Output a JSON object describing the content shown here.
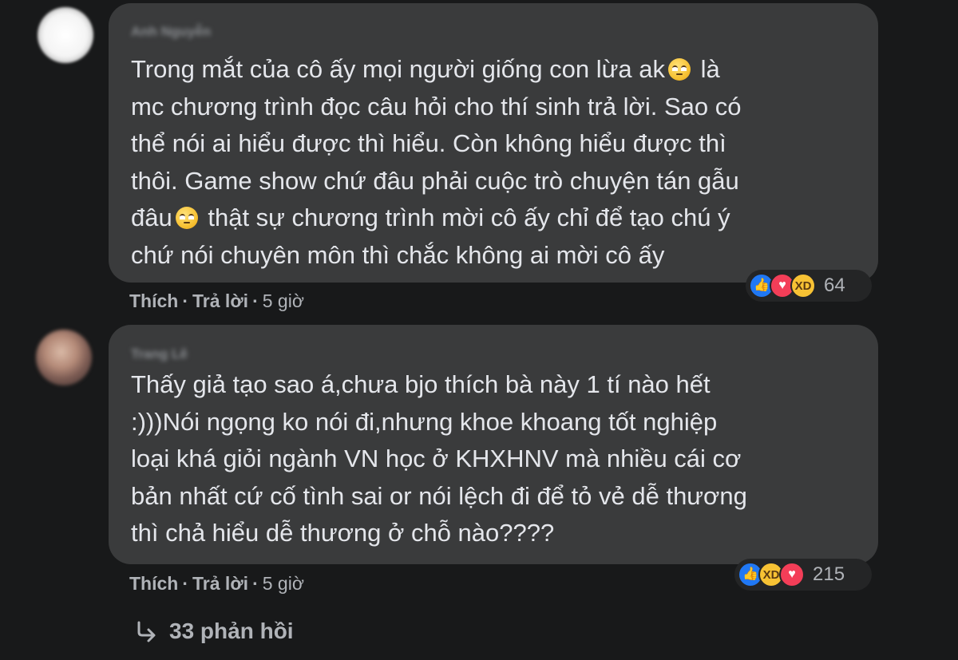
{
  "comments": [
    {
      "author": "Anh Nguyễn",
      "lines": [
        {
          "text": "Trong mắt của cô ấy mọi người giống con lừa ak",
          "emoji_after": "rolling-eyes",
          "tail": "là"
        },
        {
          "text": "mc chương trình đọc câu hỏi cho thí sinh trả lời. Sao có",
          "tail": ""
        },
        {
          "text": "thể nói ai hiểu được thì hiểu. Còn không hiểu được thì",
          "tail": ""
        },
        {
          "text": "thôi. Game show chứ đâu phải cuộc trò chuyện tán gẫu",
          "tail": ""
        },
        {
          "text": "đâu",
          "emoji_after": "rolling-eyes",
          "tail": "thật sự chương trình mời cô ấy chỉ để tạo chú ý"
        },
        {
          "text": "chứ nói chuyên môn thì chắc không ai mời cô ấy",
          "tail": ""
        }
      ],
      "reactions": [
        "like",
        "love",
        "haha"
      ],
      "reaction_count": "64",
      "like_label": "Thích",
      "reply_label": "Trả lời",
      "separator": "·",
      "time": "5 giờ"
    },
    {
      "author": "Trang Lê",
      "lines": [
        {
          "text": "Thấy giả tạo sao á,chưa bjo thích bà này 1 tí nào hết",
          "tail": ""
        },
        {
          "text": ":)))Nói ngọng ko nói đi,nhưng khoe khoang tốt nghiệp",
          "tail": ""
        },
        {
          "text": "loại khá giỏi ngành VN học ở KHXHNV mà nhiều cái cơ",
          "tail": ""
        },
        {
          "text": "bản nhất cứ cố tình sai or nói lệch đi để tỏ vẻ dễ thương",
          "tail": ""
        },
        {
          "text": "thì chả hiểu dễ thương ở chỗ nào????",
          "tail": ""
        }
      ],
      "reactions": [
        "like",
        "haha",
        "love"
      ],
      "reaction_count": "215",
      "like_label": "Thích",
      "reply_label": "Trả lời",
      "separator": "·",
      "time": "5 giờ"
    }
  ],
  "replies": {
    "icon": "reply-arrow-icon",
    "label": "33 phản hồi"
  },
  "colors": {
    "background": "#18191a",
    "bubble": "#3a3b3c",
    "text": "#e4e6eb",
    "secondary_text": "#b0b3b8",
    "like": "#2078f4",
    "love": "#f33e58",
    "haha": "#f7c234"
  }
}
